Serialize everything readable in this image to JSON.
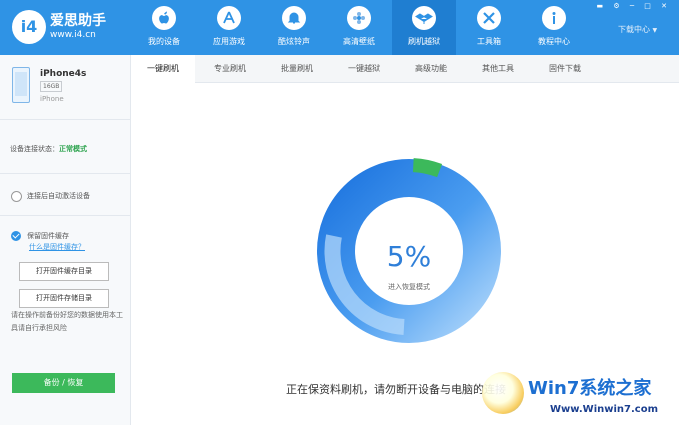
{
  "app": {
    "logo_mark": "i4",
    "name": "爱思助手",
    "url": "www.i4.cn"
  },
  "nav": {
    "items": [
      {
        "label": "我的设备",
        "icon": "apple-icon"
      },
      {
        "label": "应用游戏",
        "icon": "app-store-icon"
      },
      {
        "label": "酷炫铃声",
        "icon": "bell-icon"
      },
      {
        "label": "高清壁纸",
        "icon": "flower-icon"
      },
      {
        "label": "刷机越狱",
        "icon": "dropbox-icon",
        "active": true
      },
      {
        "label": "工具箱",
        "icon": "tools-icon"
      },
      {
        "label": "教程中心",
        "icon": "info-icon"
      }
    ],
    "download_center": "下载中心",
    "window_controls": "▬ ⚙ ─ □ ✕"
  },
  "device": {
    "name": "iPhone4s",
    "capacity": "16GB",
    "model": "iPhone"
  },
  "sidebar": {
    "status_label": "设备连接状态：",
    "status_value": "正常模式",
    "auto_activate_label": "连接后自动激活设备",
    "keep_firmware_label": "保留固件缓存",
    "what_is_cache_link": "什么是固件缓存？",
    "open_cache_dir_button": "打开固件缓存目录",
    "open_storage_dir_button": "打开固件存储目录",
    "warning_text": "请在操作前备份好您的数据使用本工具请自行承担风险",
    "backup_button": "备份 / 恢复"
  },
  "tabs": [
    "一键刷机",
    "专业刷机",
    "批量刷机",
    "一键越狱",
    "高级功能",
    "其他工具",
    "固件下载"
  ],
  "progress": {
    "percent_text": "5%",
    "percent_value": 5,
    "status_text": "进入恢复模式",
    "message": "正在保资料刷机，请勿断开设备与电脑的连接"
  },
  "watermark": {
    "brand": "Win7系统之家",
    "url": "Www.Winwin7.com"
  },
  "colors": {
    "header_blue": "#2f93e5",
    "ring_blue": "#2f7fd8",
    "ring_light": "#8cc2f5",
    "progress_green": "#3cb95b"
  }
}
